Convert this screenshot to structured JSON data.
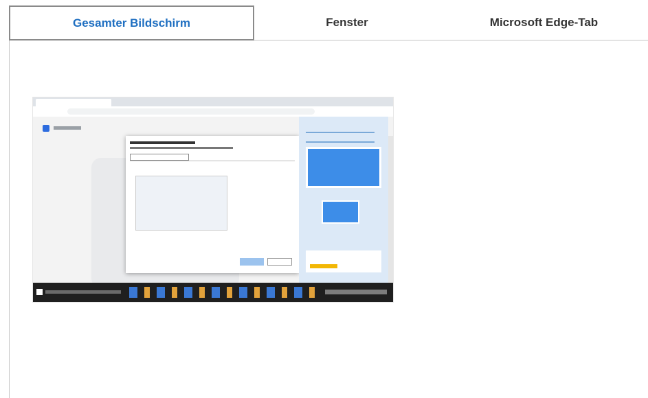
{
  "tabs": [
    {
      "label": "Gesamter Bildschirm",
      "active": true
    },
    {
      "label": "Fenster",
      "active": false
    },
    {
      "label": "Microsoft Edge-Tab",
      "active": false
    }
  ],
  "colors": {
    "active_tab_text": "#1f6fc1",
    "tab_text": "#333333",
    "active_tab_border": "#8a8a8a"
  }
}
